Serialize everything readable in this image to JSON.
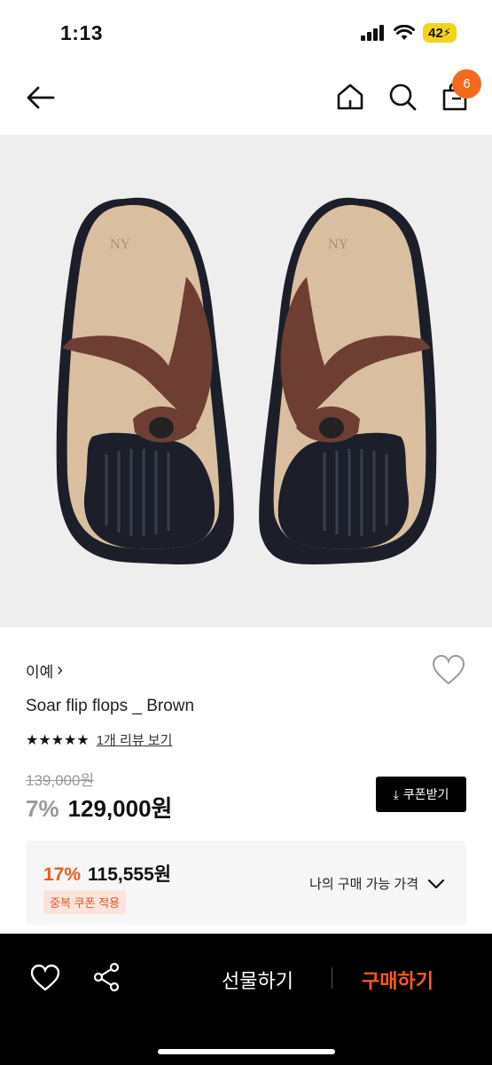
{
  "status_bar": {
    "time": "1:13",
    "battery": "42"
  },
  "nav": {
    "cart_count": "6"
  },
  "product": {
    "brand": "이예",
    "brand_chevron": "›",
    "name": "Soar flip flops _ Brown",
    "stars": "★★★★★",
    "review_link": "1개 리뷰 보기",
    "original_price": "139,000원",
    "discount": "7%",
    "price": "129,000원",
    "coupon_button": "쿠폰받기",
    "shoe_logo": "NY"
  },
  "my_price": {
    "discount": "17%",
    "amount": "115,555원",
    "tag": "중복 쿠폰 적용",
    "toggle_label": "나의 구매 가능 가격"
  },
  "bottom_bar": {
    "gift_label": "선물하기",
    "buy_label": "구매하기"
  },
  "colors": {
    "accent": "#f26a1b",
    "buy": "#ff5a1f",
    "image_bg": "#eeeeef",
    "sole": "#1c1f2a",
    "strap": "#6e3e33",
    "footbed": "#d9bf9f"
  }
}
